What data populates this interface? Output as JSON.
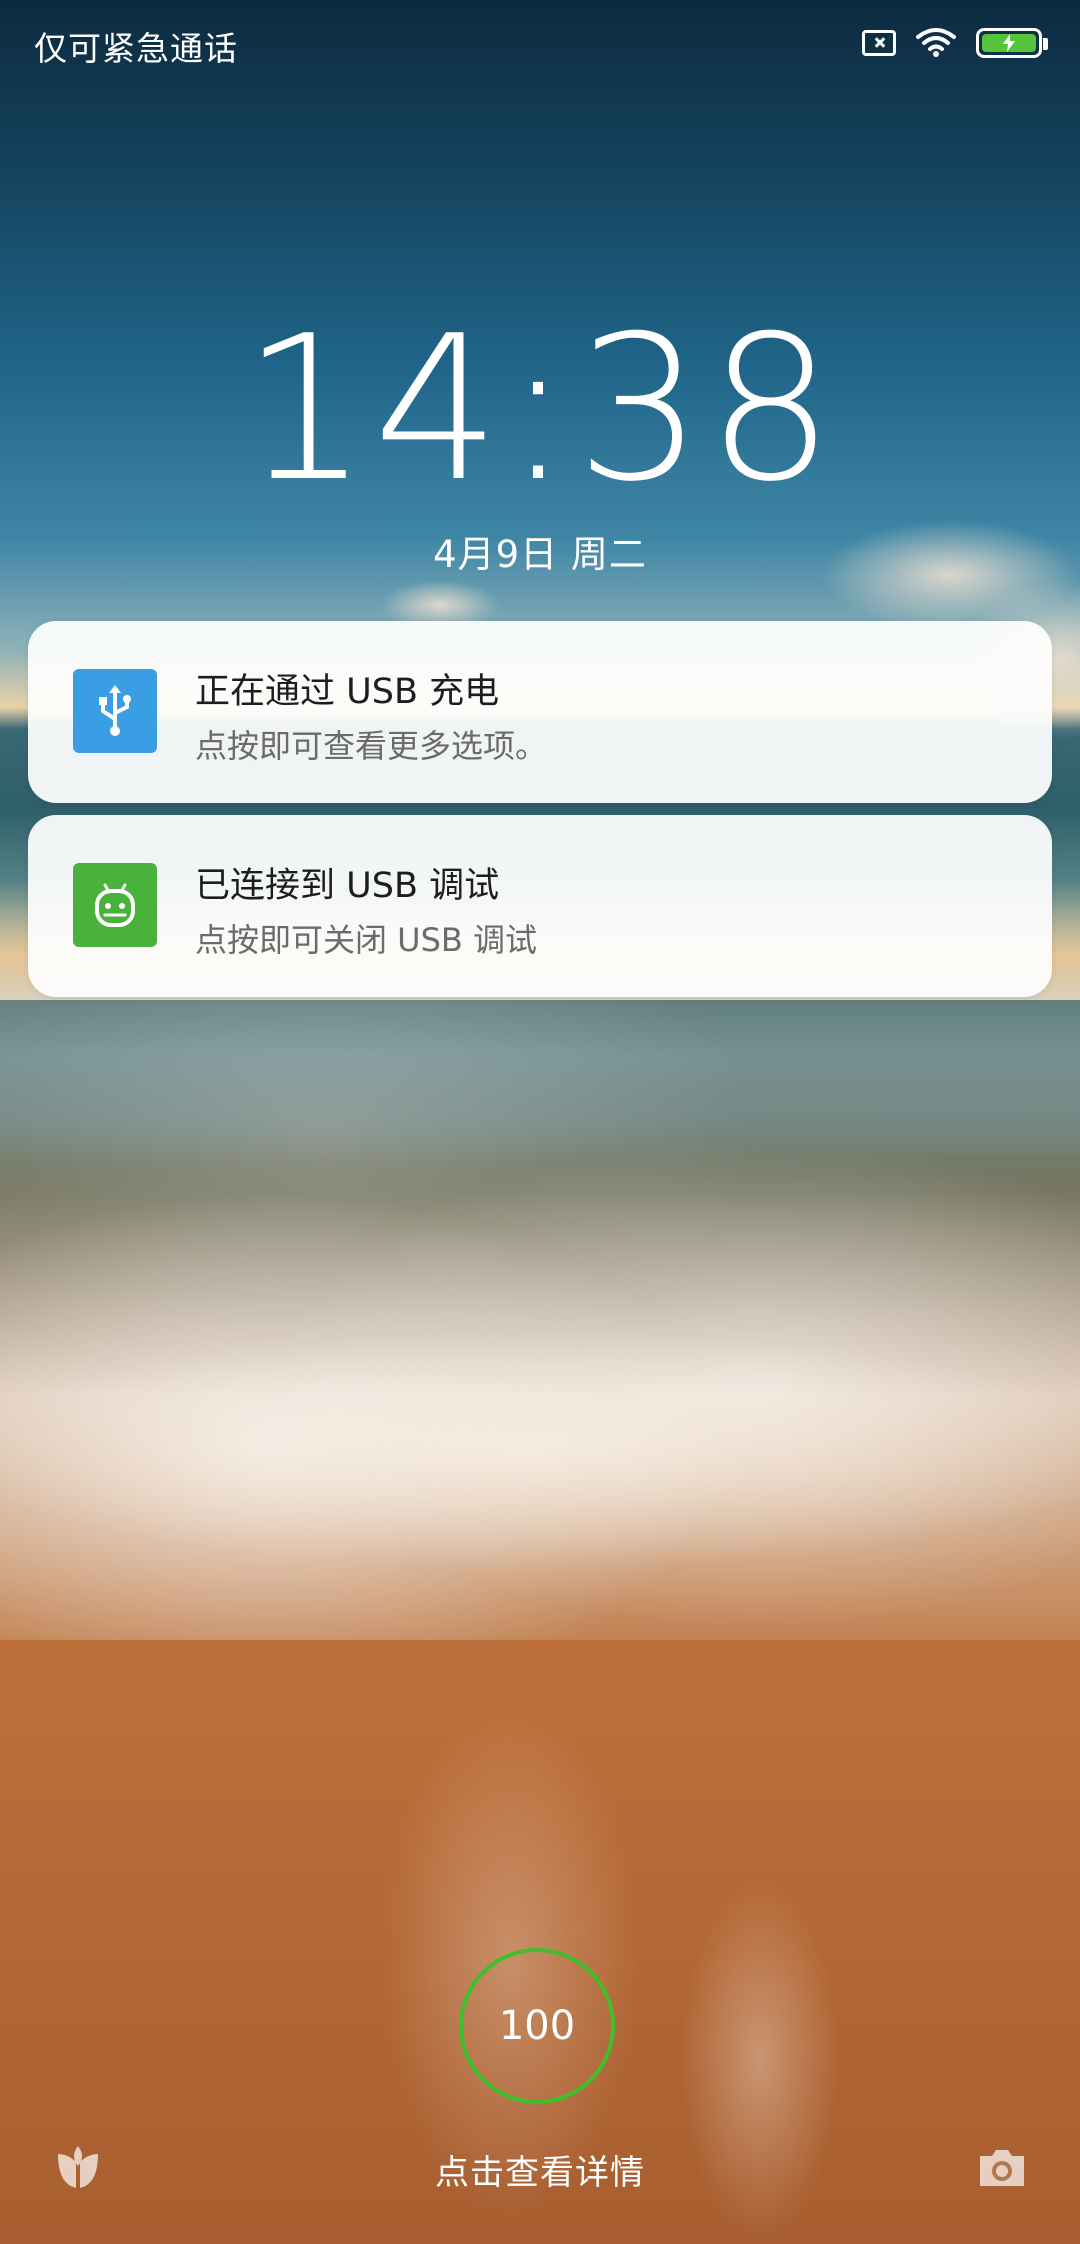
{
  "status_bar": {
    "carrier_text": "仅可紧急通话",
    "icons": [
      "no-sim-icon",
      "wifi-icon",
      "battery-charging-icon"
    ],
    "battery_color": "#55c43a"
  },
  "lockscreen": {
    "time": "14:38",
    "date": "4月9日  周二"
  },
  "notifications": [
    {
      "icon": "usb-icon",
      "icon_color": "#3a9ee4",
      "title": "正在通过  USB  充电",
      "text": "点按即可查看更多选项。"
    },
    {
      "icon": "android-debug-icon",
      "icon_color": "#48b23d",
      "title": "已连接到  USB  调试",
      "text": "点按即可关闭 USB 调试"
    }
  ],
  "bottom": {
    "battery_level": "100",
    "battery_ring_color": "#3fbf2c",
    "hint": "点击查看详情",
    "left_shortcut": "leaf-icon",
    "right_shortcut": "camera-icon"
  }
}
